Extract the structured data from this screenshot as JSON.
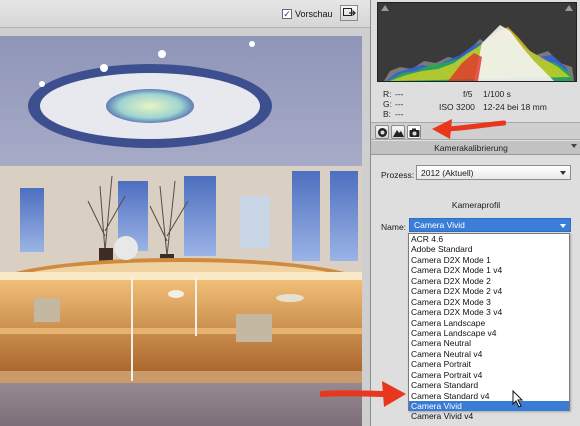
{
  "toolbar": {
    "preview_label": "Vorschau",
    "preview_checked": true
  },
  "info": {
    "r_label": "R:",
    "r_value": "---",
    "g_label": "G:",
    "g_value": "---",
    "b_label": "B:",
    "b_value": "---",
    "aperture": "f/5",
    "shutter": "1/100 s",
    "iso": "ISO 3200",
    "lens": "12-24 bei 18 mm"
  },
  "tabs": [
    {
      "name": "tab-basic",
      "icon": "aperture-icon"
    },
    {
      "name": "tab-tone-curve",
      "icon": "mountain-icon"
    },
    {
      "name": "tab-camera-calibration",
      "icon": "camera-icon",
      "active": true
    }
  ],
  "section": {
    "title": "Kamerakalibrierung"
  },
  "process": {
    "label": "Prozess:",
    "value": "2012 (Aktuell)"
  },
  "profile": {
    "heading": "Kameraprofil",
    "name_label": "Name:",
    "selected": "Camera Vivid",
    "options": [
      "ACR 4.6",
      "Adobe Standard",
      "Camera D2X Mode 1",
      "Camera D2X Mode 1 v4",
      "Camera D2X Mode 2",
      "Camera D2X Mode 2 v4",
      "Camera D2X Mode 3",
      "Camera D2X Mode 3 v4",
      "Camera Landscape",
      "Camera Landscape v4",
      "Camera Neutral",
      "Camera Neutral v4",
      "Camera Portrait",
      "Camera Portrait v4",
      "Camera Standard",
      "Camera Standard v4",
      "Camera Vivid",
      "Camera Vivid v4"
    ],
    "highlighted_index": 16
  },
  "colors": {
    "selection": "#3a7bd5",
    "annotation_arrow": "#e8371c",
    "panel_bg": "#dedede"
  }
}
